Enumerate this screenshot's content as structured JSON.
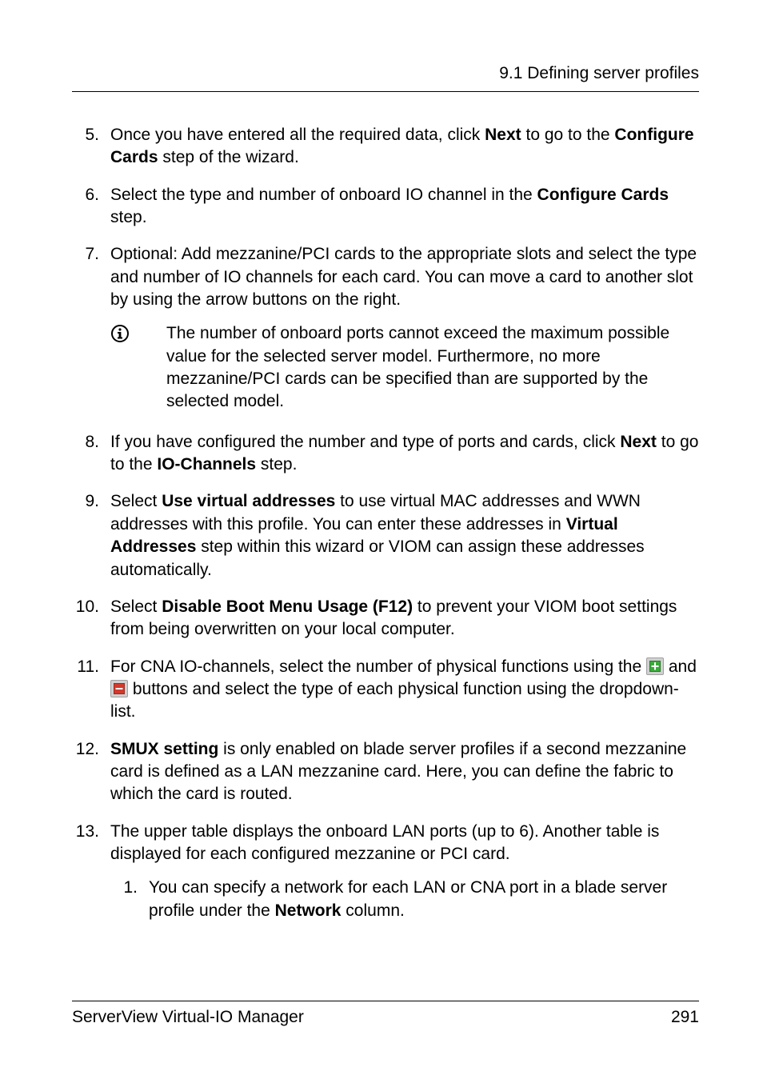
{
  "header": {
    "section": "9.1 Defining server profiles"
  },
  "steps": {
    "s5": {
      "num": "5.",
      "t1": "Once you have entered all the required data, click ",
      "b1": "Next",
      "t2": " to go to the ",
      "b2": "Configure Cards",
      "t3": " step of the wizard."
    },
    "s6": {
      "num": "6.",
      "t1": "Select the type and number of onboard IO channel in the ",
      "b1": "Configure Cards",
      "t2": " step."
    },
    "s7": {
      "num": "7.",
      "t1": "Optional: Add mezzanine/PCI cards to the appropriate slots and select the type and number of IO channels for each card. You can move a card to another slot by using the arrow buttons on the right.",
      "info": "The number of onboard ports cannot exceed the maximum possible value for the selected server model. Furthermore, no more mezzanine/PCI cards can be specified than are supported by the selected model."
    },
    "s8": {
      "num": "8.",
      "t1": "If you have configured the number and type of ports and cards, click ",
      "b1": "Next",
      "t2": " to go to the ",
      "b2": "IO-Channels",
      "t3": " step."
    },
    "s9": {
      "num": "9.",
      "t1": "Select ",
      "b1": "Use virtual addresses",
      "t2": " to use virtual MAC addresses and WWN addresses with this profile. You can enter these addresses in ",
      "b2": "Virtual Addresses",
      "t3": " step within this wizard or VIOM can assign these addresses automatically."
    },
    "s10": {
      "num": "10.",
      "t1": "Select ",
      "b1": "Disable Boot Menu Usage (F12)",
      "t2": " to prevent your VIOM boot settings from being overwritten on your local computer."
    },
    "s11": {
      "num": "11.",
      "t1": "For CNA IO-channels, select the number of physical functions using the ",
      "t2": " and ",
      "t3": " buttons and select the type of each physical function using the dropdown-list."
    },
    "s12": {
      "num": "12.",
      "b1": "SMUX setting",
      "t1": " is only enabled on blade server profiles if a second mezzanine card is defined as a LAN mezzanine card. Here, you can define the fabric to which the card is routed."
    },
    "s13": {
      "num": "13.",
      "t1": "The upper table displays the onboard LAN ports (up to 6). Another table is displayed for each configured mezzanine or PCI card.",
      "sub1": {
        "num": "1.",
        "t1": "You can specify a network for each LAN or CNA port in a blade server profile under the ",
        "b1": "Network",
        "t2": " column."
      }
    }
  },
  "footer": {
    "product": "ServerView Virtual-IO Manager",
    "page": "291"
  }
}
